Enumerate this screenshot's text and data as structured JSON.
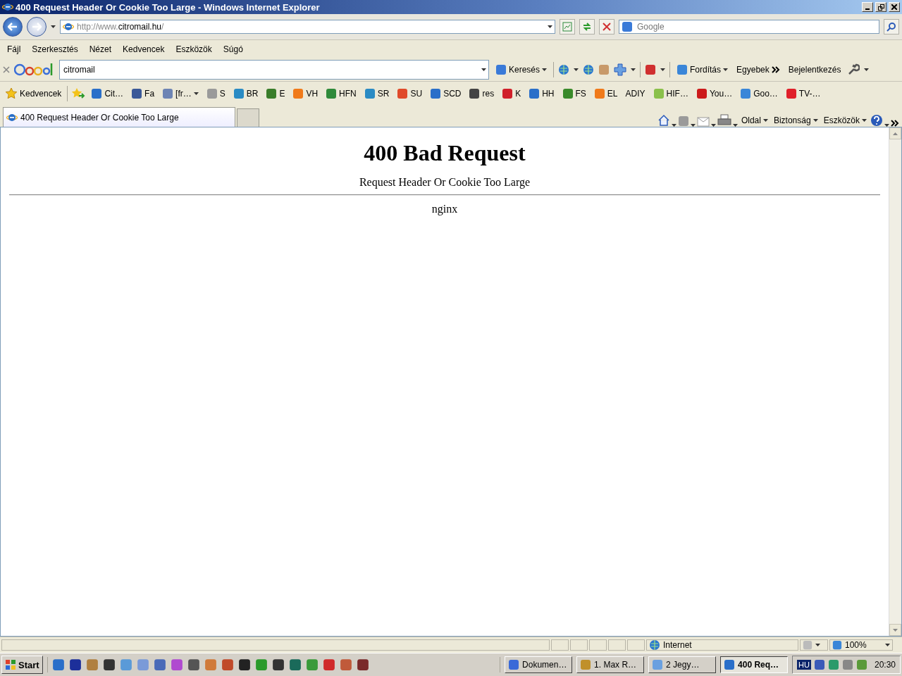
{
  "window": {
    "title": "400 Request Header Or Cookie Too Large - Windows Internet Explorer"
  },
  "address": {
    "prefix": "http://www.",
    "host": "citromail.hu",
    "suffix": "/"
  },
  "search": {
    "placeholder": "Google"
  },
  "menu": [
    "Fájl",
    "Szerkesztés",
    "Nézet",
    "Kedvencek",
    "Eszközök",
    "Súgó"
  ],
  "google_toolbar": {
    "query": "citromail",
    "search_button": "Keresés",
    "translate": "Fordítás",
    "more": "Egyebek",
    "signin": "Bejelentkezés"
  },
  "favorites": {
    "label": "Kedvencek",
    "items": [
      {
        "label": "Cit…",
        "color": "#2a6fc9",
        "has_menu": false
      },
      {
        "label": "Fa",
        "color": "#3b5998",
        "has_menu": false
      },
      {
        "label": "[fr…",
        "color": "#6d84b4",
        "has_menu": true
      },
      {
        "label": "S",
        "color": "#9a9a9a",
        "has_menu": false
      },
      {
        "label": "BR",
        "color": "#2a8bc4",
        "has_menu": false
      },
      {
        "label": "E",
        "color": "#3a7d2a",
        "has_menu": false
      },
      {
        "label": "VH",
        "color": "#f07a1a",
        "has_menu": false
      },
      {
        "label": "HFN",
        "color": "#2f8a3a",
        "has_menu": false
      },
      {
        "label": "SR",
        "color": "#2a8bc4",
        "has_menu": false
      },
      {
        "label": "SU",
        "color": "#e04a2a",
        "has_menu": false
      },
      {
        "label": "SCD",
        "color": "#2a6fc9",
        "has_menu": false
      },
      {
        "label": "res",
        "color": "#444444",
        "has_menu": false
      },
      {
        "label": "K",
        "color": "#d0202a",
        "has_menu": false
      },
      {
        "label": "HH",
        "color": "#2a6fc9",
        "has_menu": false
      },
      {
        "label": "FS",
        "color": "#3a8a2a",
        "has_menu": false
      },
      {
        "label": "EL",
        "color": "#f07a1a",
        "has_menu": false
      },
      {
        "label": "ADIY",
        "has_menu": false
      },
      {
        "label": "HIF…",
        "color": "#8ac04a",
        "has_menu": false
      },
      {
        "label": "You…",
        "color": "#cc1a1a",
        "has_menu": false
      },
      {
        "label": "Goo…",
        "color": "#3a86d8",
        "has_menu": false
      },
      {
        "label": "TV-…",
        "color": "#e0202a",
        "has_menu": false
      }
    ]
  },
  "tabs": [
    {
      "label": "400 Request Header Or Cookie Too Large",
      "selected": true
    }
  ],
  "command_bar": [
    "Oldal",
    "Biztonság",
    "Eszközök"
  ],
  "page": {
    "heading": "400 Bad Request",
    "message": "Request Header Or Cookie Too Large",
    "server": "nginx"
  },
  "status_bar": {
    "zone": "Internet",
    "zoom": "100%"
  },
  "taskbar": {
    "start": "Start",
    "tasks": [
      {
        "label": "Dokumen…",
        "selected": false
      },
      {
        "label": "1. Max R…",
        "selected": false
      },
      {
        "label": "2 Jegy…",
        "selected": false
      },
      {
        "label": "400 Req…",
        "selected": true
      }
    ],
    "language": "HU",
    "clock": "20:30"
  }
}
